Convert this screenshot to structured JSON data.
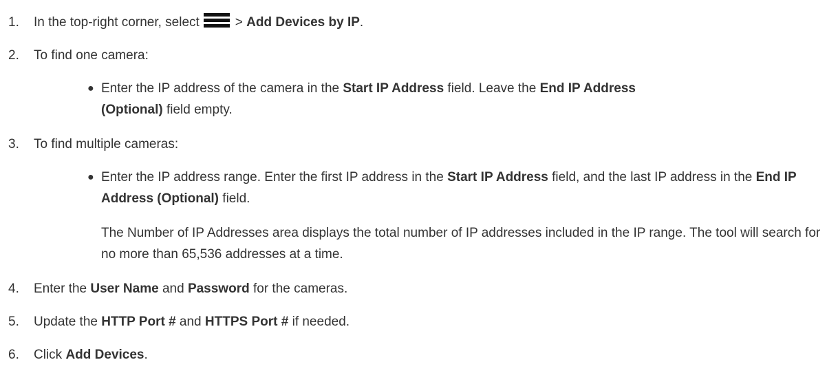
{
  "steps": [
    {
      "number": "1.",
      "parts": [
        "In the top-right corner, select",
        "> ",
        "Add Devices by IP",
        "."
      ]
    },
    {
      "number": "2.",
      "text": "To find one camera:",
      "bullet": {
        "parts": [
          "Enter the IP address of the camera in the ",
          "Start IP Address",
          " field. Leave the ",
          "End IP Address",
          "(Optional)",
          " field empty."
        ]
      }
    },
    {
      "number": "3.",
      "text": "To find multiple cameras:",
      "bullet": {
        "parts": [
          "Enter the IP address range. Enter the first IP address in the ",
          "Start IP Address",
          " field, and the last IP address in the ",
          "End IP Address (Optional)",
          " field."
        ]
      },
      "note": "The Number of IP Addresses area displays the total number of IP addresses included in the IP range. The tool will search for no more than 65,536 addresses at a time."
    },
    {
      "number": "4.",
      "parts": [
        "Enter the ",
        "User Name",
        " and ",
        "Password",
        " for the cameras."
      ]
    },
    {
      "number": "5.",
      "parts": [
        "Update the ",
        "HTTP Port #",
        " and ",
        "HTTPS Port #",
        " if needed."
      ]
    },
    {
      "number": "6.",
      "parts": [
        "Click ",
        "Add Devices",
        "."
      ]
    }
  ],
  "icons": {
    "menu": "hamburger-menu-icon"
  }
}
